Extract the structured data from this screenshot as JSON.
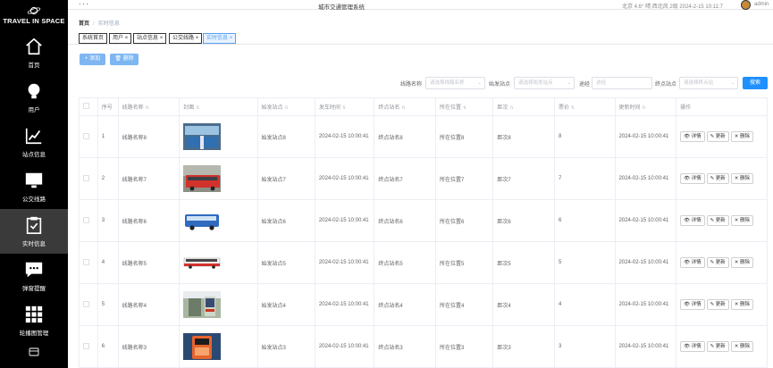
{
  "brand": {
    "name": "TRAVEL IN SPACE"
  },
  "sidebar": {
    "items": [
      {
        "label": "首页",
        "icon": "home-icon"
      },
      {
        "label": "用户",
        "icon": "lightbulb-icon"
      },
      {
        "label": "站点信息",
        "icon": "trend-chart-icon"
      },
      {
        "label": "公交线路",
        "icon": "monitor-icon"
      },
      {
        "label": "实时信息",
        "icon": "clipboard-check-icon"
      },
      {
        "label": "弹窗提醒",
        "icon": "chat-bubble-icon"
      },
      {
        "label": "轮播图管理",
        "icon": "grid-icon"
      }
    ],
    "active_index": 4
  },
  "header": {
    "title": "城市交通管理系统",
    "weather": "北京 4.6° 晴 西北风 2级 2024-2-15 10:11:7",
    "user": "admin"
  },
  "breadcrumb": {
    "home": "首页",
    "separator": "/",
    "current": "实时信息"
  },
  "tabs": [
    {
      "label": "系统首页",
      "closable": false
    },
    {
      "label": "用户",
      "closable": true
    },
    {
      "label": "站点信息",
      "closable": true
    },
    {
      "label": "公交线路",
      "closable": true
    },
    {
      "label": "实时信息",
      "closable": true,
      "active": true
    }
  ],
  "toolbar": {
    "add_label": "+ 添加",
    "delete_label": "🗑 删除"
  },
  "filters": {
    "route_name_label": "线路名称",
    "route_name_placeholder": "请选择线路名称",
    "start_label": "始发站点",
    "start_placeholder": "请选择始发站点",
    "via_label": "途经",
    "via_placeholder": "途经",
    "end_label": "终点站点",
    "end_placeholder": "请选择终点站",
    "search_label": "搜索"
  },
  "table": {
    "columns": [
      "序号",
      "线路名称",
      "封面",
      "始发站点",
      "发车时间",
      "终点站名",
      "所在位置",
      "距次",
      "票价",
      "更新时间",
      "操作"
    ],
    "actions": {
      "detail": "详情",
      "update": "更新",
      "delete": "删除"
    },
    "rows": [
      {
        "index": "1",
        "route": "线路名称8",
        "cover": "bus-interior",
        "start": "始发站点8",
        "depart_time": "2024-02-15 10:00:41",
        "end": "终点站名8",
        "location": "所在位置8",
        "distance": "距次8",
        "price": "8",
        "updated": "2024-02-15 10:00:41"
      },
      {
        "index": "2",
        "route": "线路名称7",
        "cover": "red-bus",
        "start": "始发站点7",
        "depart_time": "2024-02-15 10:00:41",
        "end": "终点站名7",
        "location": "所在位置7",
        "distance": "距次7",
        "price": "7",
        "updated": "2024-02-15 10:00:41"
      },
      {
        "index": "3",
        "route": "线路名称6",
        "cover": "blue-bus",
        "start": "始发站点6",
        "depart_time": "2024-02-15 10:00:41",
        "end": "终点站名6",
        "location": "所在位置6",
        "distance": "距次6",
        "price": "6",
        "updated": "2024-02-15 10:00:41"
      },
      {
        "index": "4",
        "route": "线路名称5",
        "cover": "white-red-bus",
        "start": "始发站点5",
        "depart_time": "2024-02-15 10:00:41",
        "end": "终点站名5",
        "location": "所在位置5",
        "distance": "距次5",
        "price": "5",
        "updated": "2024-02-15 10:00:41"
      },
      {
        "index": "5",
        "route": "线路名称4",
        "cover": "bus-stop",
        "start": "始发站点4",
        "depart_time": "2024-02-15 10:00:41",
        "end": "终点站名4",
        "location": "所在位置4",
        "distance": "距次4",
        "price": "4",
        "updated": "2024-02-15 10:00:41"
      },
      {
        "index": "6",
        "route": "线路名称3",
        "cover": "card-reader",
        "start": "始发站点3",
        "depart_time": "2024-02-15 10:00:41",
        "end": "终点站名3",
        "location": "所在位置3",
        "distance": "距次3",
        "price": "3",
        "updated": "2024-02-15 10:00:41"
      }
    ]
  }
}
